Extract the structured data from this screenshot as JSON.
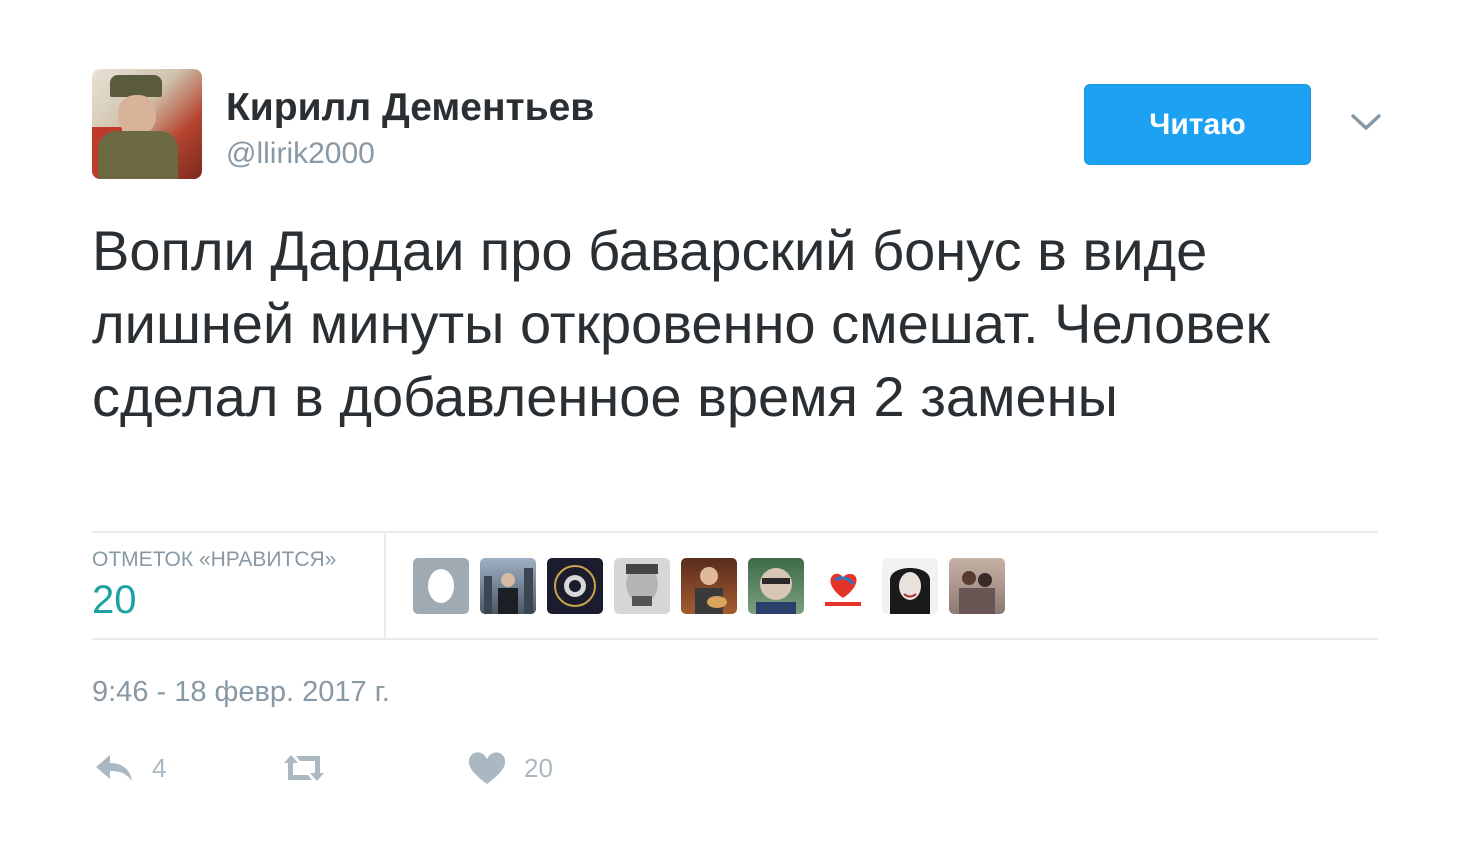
{
  "author": {
    "name": "Кирилл Дементьев",
    "handle": "@llirik2000"
  },
  "follow_button": {
    "label": "Читаю"
  },
  "tweet": {
    "text": "Вопли Дардаи про баварский бонус в виде лишней минуты откровенно смешат. Человек сделал в добавленное время 2 замены"
  },
  "stats": {
    "likes_label": "ОТМЕТОК «НРАВИТСЯ»",
    "likes_count": "20"
  },
  "likers": [
    {
      "avatar": "default-egg-avatar",
      "bg": "#a0aab3"
    },
    {
      "avatar": "man-skyline-avatar",
      "bg": "#6d7f93"
    },
    {
      "avatar": "dfb-crest-avatar",
      "bg": "#1b1d2e"
    },
    {
      "avatar": "man-grayscale-avatar",
      "bg": "#c9c9c9"
    },
    {
      "avatar": "musician-avatar",
      "bg": "#8a4b2b"
    },
    {
      "avatar": "glasses-man-avatar",
      "bg": "#4c6b52"
    },
    {
      "avatar": "heart-logo-avatar",
      "bg": "#ffffff"
    },
    {
      "avatar": "woman-bw-avatar",
      "bg": "#222222"
    },
    {
      "avatar": "woman-group-avatar",
      "bg": "#b8a49a"
    }
  ],
  "timestamp": "9:46 - 18 февр. 2017 г.",
  "actions": {
    "reply_count": "4",
    "like_count": "20"
  },
  "colors": {
    "accent": "#1da1f2",
    "likes_teal": "#1da1a2",
    "muted": "#8899a6",
    "icon": "#aab8c2",
    "text": "#292f33"
  }
}
